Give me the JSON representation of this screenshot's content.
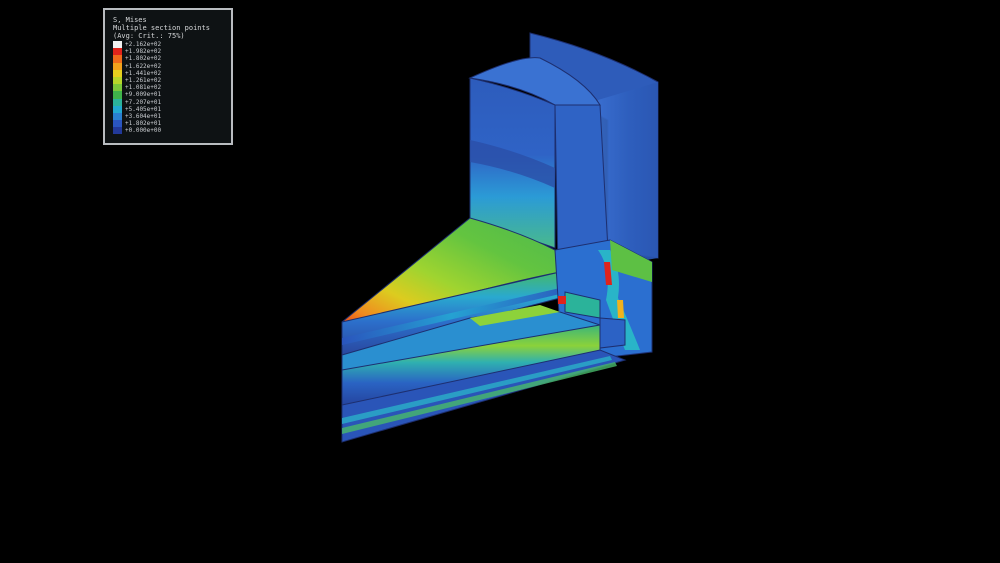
{
  "legend": {
    "title": "S, Mises",
    "subtitle": "Multiple section points",
    "criterion": "(Avg: Crit.: 75%)",
    "entries": [
      {
        "label": "+2.162e+02",
        "color": "#f2f2f2"
      },
      {
        "label": "+1.982e+02",
        "color": "#e0231b"
      },
      {
        "label": "+1.802e+02",
        "color": "#ef6a1c"
      },
      {
        "label": "+1.622e+02",
        "color": "#f2a21c"
      },
      {
        "label": "+1.441e+02",
        "color": "#e7d11e"
      },
      {
        "label": "+1.261e+02",
        "color": "#b7d72a"
      },
      {
        "label": "+1.081e+02",
        "color": "#7cc83a"
      },
      {
        "label": "+9.009e+01",
        "color": "#3fb34a"
      },
      {
        "label": "+7.207e+01",
        "color": "#2bb39a"
      },
      {
        "label": "+5.405e+01",
        "color": "#22a9d0"
      },
      {
        "label": "+3.604e+01",
        "color": "#2a7fd0"
      },
      {
        "label": "+1.802e+01",
        "color": "#2a55c0"
      },
      {
        "label": "+0.000e+00",
        "color": "#22399a"
      }
    ]
  },
  "colors": {
    "background": "#000000",
    "part_blue": "#2c5fbd",
    "part_dark_blue": "#243f94",
    "high_stress": "#e0231b"
  }
}
